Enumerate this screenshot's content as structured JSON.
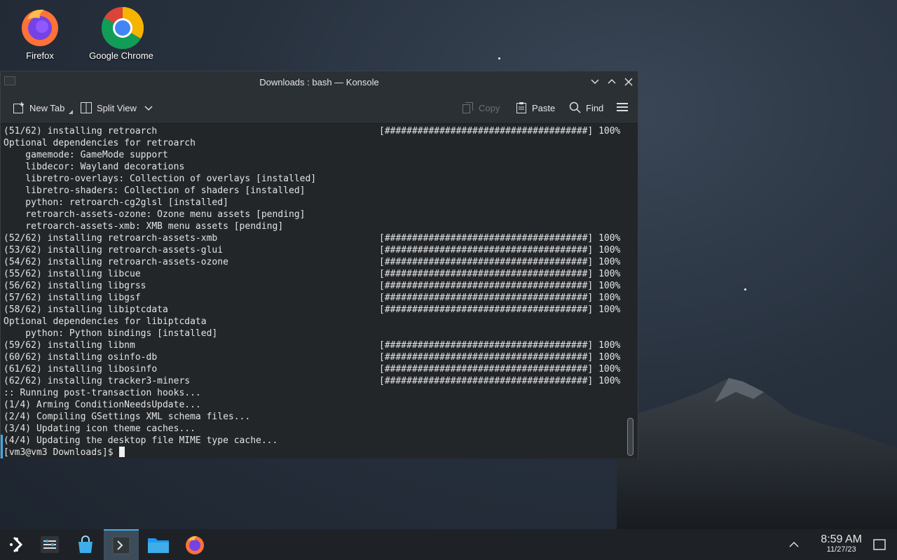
{
  "desktop": {
    "icons": [
      {
        "label": "Firefox"
      },
      {
        "label": "Google Chrome"
      }
    ]
  },
  "window": {
    "title": "Downloads : bash — Konsole",
    "toolbar": {
      "new_tab": "New Tab",
      "split_view": "Split View",
      "copy": "Copy",
      "paste": "Paste",
      "find": "Find"
    }
  },
  "terminal": {
    "lines": [
      "(51/62) installing retroarch",
      "Optional dependencies for retroarch",
      "    gamemode: GameMode support",
      "    libdecor: Wayland decorations",
      "    libretro-overlays: Collection of overlays [installed]",
      "    libretro-shaders: Collection of shaders [installed]",
      "    python: retroarch-cg2glsl [installed]",
      "    retroarch-assets-ozone: Ozone menu assets [pending]",
      "    retroarch-assets-xmb: XMB menu assets [pending]",
      "(52/62) installing retroarch-assets-xmb",
      "(53/62) installing retroarch-assets-glui",
      "(54/62) installing retroarch-assets-ozone",
      "(55/62) installing libcue",
      "(56/62) installing libgrss",
      "(57/62) installing libgsf",
      "(58/62) installing libiptcdata",
      "Optional dependencies for libiptcdata",
      "    python: Python bindings [installed]",
      "(59/62) installing libnm",
      "(60/62) installing osinfo-db",
      "(61/62) installing libosinfo",
      "(62/62) installing tracker3-miners",
      ":: Running post-transaction hooks...",
      "(1/4) Arming ConditionNeedsUpdate...",
      "(2/4) Compiling GSettings XML schema files...",
      "(3/4) Updating icon theme caches...",
      "(4/4) Updating the desktop file MIME type cache..."
    ],
    "progress_bar": "[#####################################] 100%",
    "progress_rows": [
      0,
      9,
      10,
      11,
      12,
      13,
      14,
      15,
      18,
      19,
      20,
      21
    ],
    "prompt": "[vm3@vm3 Downloads]$ "
  },
  "taskbar": {
    "time": "8:59 AM",
    "date": "11/27/23"
  }
}
